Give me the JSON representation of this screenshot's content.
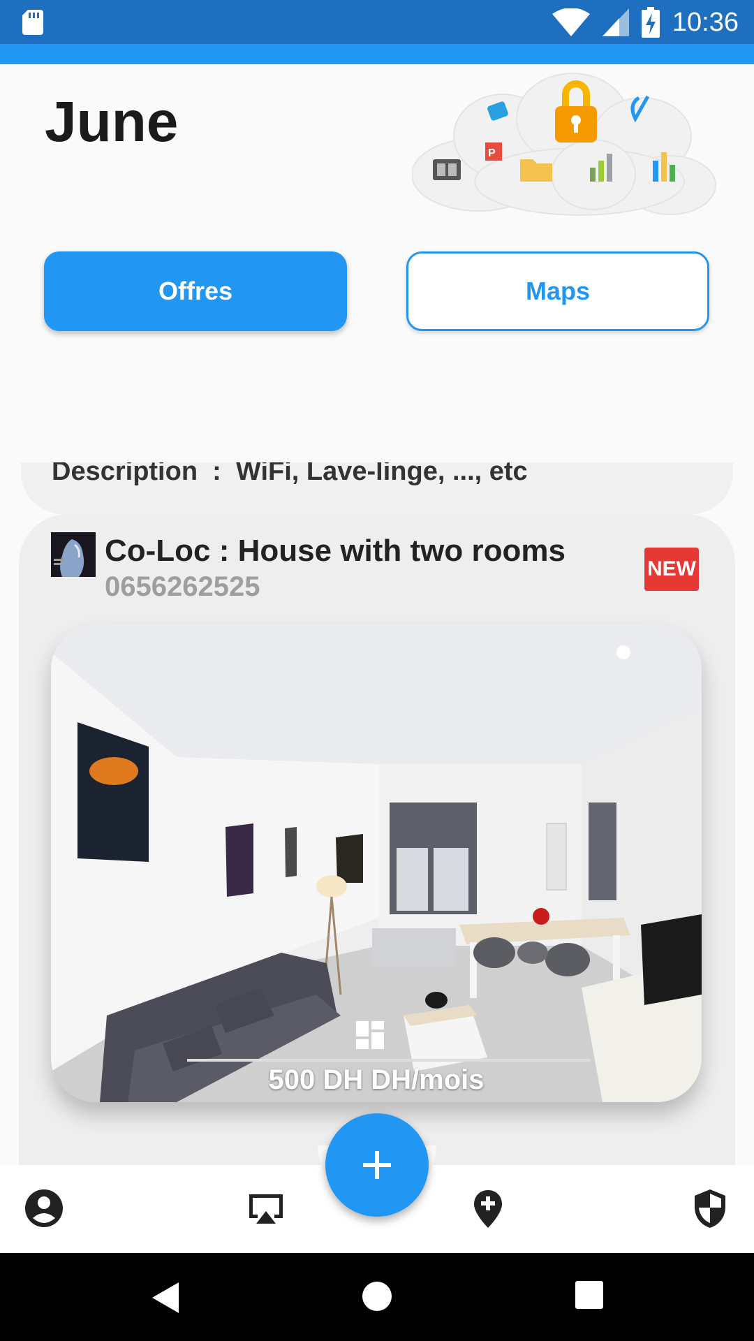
{
  "status_bar": {
    "time": "10:36"
  },
  "header": {
    "title": "June"
  },
  "buttons": {
    "offres": "Offres",
    "maps": "Maps"
  },
  "previous_card": {
    "description": "Description  :  WiFi, Lave-linge, ..., etc"
  },
  "listing": {
    "title": "Co-Loc : House with two rooms",
    "phone": "0656262525",
    "badge": "NEW",
    "price": "500 DH DH/mois"
  },
  "bottom_nav": {
    "items": [
      "profile-icon",
      "cast-icon",
      "add-location-icon",
      "security-icon"
    ],
    "fab": "add-icon"
  },
  "colors": {
    "primary": "#2196f3",
    "status_bar": "#1e6fbf",
    "badge": "#e53935"
  }
}
